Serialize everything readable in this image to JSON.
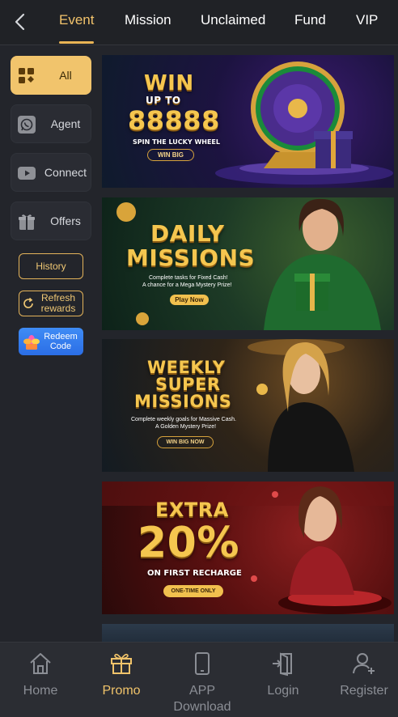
{
  "header": {
    "back_icon": "chevron-left-icon",
    "tabs": [
      {
        "label": "Event",
        "active": true
      },
      {
        "label": "Mission",
        "active": false
      },
      {
        "label": "Unclaimed",
        "active": false
      },
      {
        "label": "Fund",
        "active": false
      },
      {
        "label": "VIP",
        "active": false
      }
    ]
  },
  "sidebar": {
    "items": [
      {
        "label": "All",
        "icon": "grid-suits-icon",
        "active": true
      },
      {
        "label": "Agent",
        "icon": "whatsapp-icon",
        "active": false
      },
      {
        "label": "Connect",
        "icon": "youtube-icon",
        "active": false
      },
      {
        "label": "Offers",
        "icon": "gift-box-icon",
        "active": false
      }
    ],
    "history_label": "History",
    "refresh_label": "Refresh rewards",
    "redeem_label": "Redeem Code"
  },
  "banners": [
    {
      "line1": "WIN",
      "line2": "UP TO",
      "amount": "88888",
      "sub": "SPIN THE LUCKY WHEEL",
      "cta": "WIN BIG"
    },
    {
      "line1": "DAILY",
      "line2": "MISSIONS",
      "sub1": "Complete tasks for Fixed Cash!",
      "sub2": "A chance for a Mega Mystery Prize!",
      "cta": "Play Now"
    },
    {
      "line1": "WEEKLY",
      "line2": "SUPER",
      "line3": "MISSIONS",
      "sub1": "Complete weekly goals for Massive Cash.",
      "sub2": "A Golden Mystery Prize!",
      "cta": "WIN BIG NOW"
    },
    {
      "line1": "EXTRA",
      "amount": "20%",
      "sub": "ON FIRST RECHARGE",
      "cta": "ONE-TIME ONLY"
    }
  ],
  "bottom_nav": [
    {
      "label": "Home",
      "icon": "home-icon",
      "active": false
    },
    {
      "label": "Promo",
      "icon": "gift-icon",
      "active": true
    },
    {
      "label": "APP Download",
      "icon": "phone-icon",
      "active": false
    },
    {
      "label": "Login",
      "icon": "login-door-icon",
      "active": false
    },
    {
      "label": "Register",
      "icon": "add-user-icon",
      "active": false
    }
  ],
  "colors": {
    "background": "#23252b",
    "accent": "#f1c46c",
    "redeem_blue": "#3f8cf5"
  }
}
